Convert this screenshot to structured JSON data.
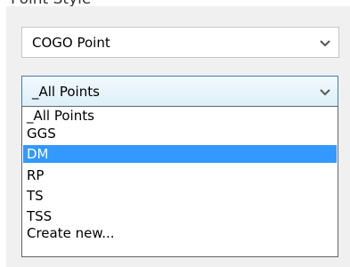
{
  "header": {
    "partial_label": "Point Style"
  },
  "style_dropdown": {
    "selected": "COGO Point"
  },
  "layer_dropdown": {
    "selected": "_All Points",
    "options": [
      "_All Points",
      "GGS",
      "DM",
      "RP",
      "TS",
      "TSS",
      "Create new..."
    ],
    "highlighted": "DM"
  },
  "icons": {
    "dropdown_arrow": "chevron-down-icon"
  },
  "colors": {
    "selection_bg": "#3399ff",
    "selection_text": "#ffffff",
    "focus_border": "#3c7fb1",
    "panel_bg": "#f0f0f0"
  }
}
